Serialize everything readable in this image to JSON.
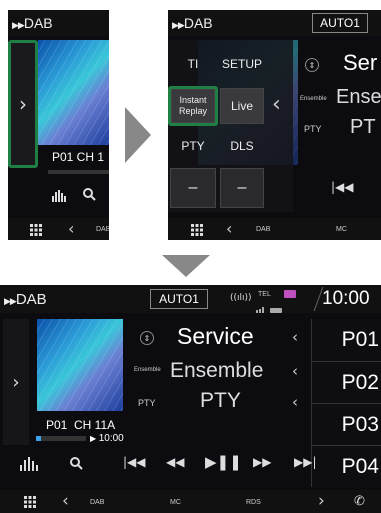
{
  "screen1": {
    "title": "DAB",
    "station": "P01 CH 1",
    "open_arrow": "›"
  },
  "screen2": {
    "title": "DAB",
    "auto_button": "AUTO1",
    "menu": {
      "ti": "TI",
      "setup": "SETUP",
      "instant_replay_line1": "Instant",
      "instant_replay_line2": "Replay",
      "live": "Live",
      "pty": "PTY",
      "dls": "DLS",
      "minus1": "–",
      "minus2": "–"
    },
    "info": {
      "service_value": "Ser",
      "ensemble_label": "Ensemble",
      "ensemble_value": "Ense",
      "pty_label": "PTY",
      "pty_value": "PT"
    },
    "bottom": {
      "dab": "DAB",
      "mc": "MC"
    }
  },
  "screen3": {
    "title": "DAB",
    "auto_button": "AUTO1",
    "tel_label": "TEL",
    "clock": "10:00",
    "service": "Service",
    "ensemble_label": "Ensemble",
    "ensemble": "Ensemble",
    "pty_label": "PTY",
    "pty": "PTY",
    "station": "P01  CH 11A",
    "time": "10:00",
    "presets": [
      "P01",
      "P02",
      "P03",
      "P04"
    ],
    "bottom": {
      "dab": "DAB",
      "mc": "MC",
      "rds": "RDS"
    }
  }
}
